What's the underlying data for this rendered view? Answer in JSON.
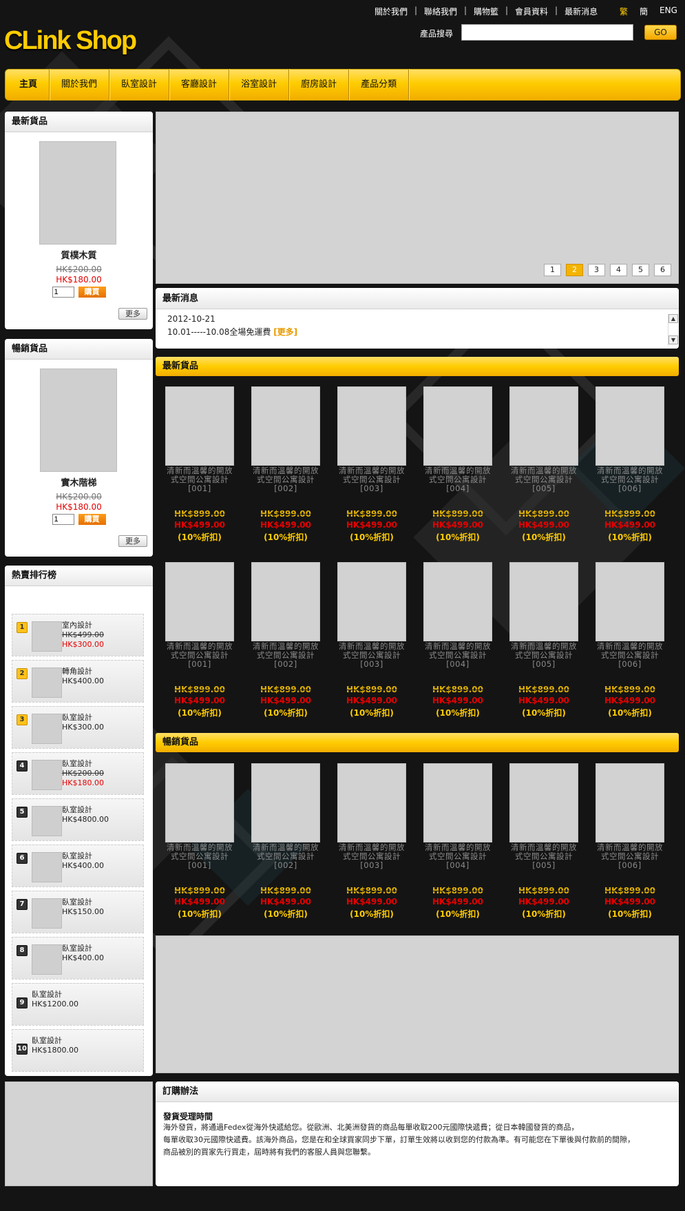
{
  "header": {
    "logo": "CLink Shop",
    "top_links": [
      "關於我們",
      "聯絡我們",
      "購物籃",
      "會員資料",
      "最新消息"
    ],
    "languages": [
      "繁",
      "簡",
      "ENG"
    ],
    "search_label": "產品搜尋",
    "search_value": "",
    "search_button": "GO"
  },
  "nav": [
    "主頁",
    "關於我們",
    "臥室設計",
    "客廳設計",
    "浴室設計",
    "廚房設計",
    "產品分類"
  ],
  "latest_side": {
    "title": "最新貨品",
    "name": "質樸木質",
    "old_price": "HK$200.00",
    "new_price": "HK$180.00",
    "qty": "1",
    "buy": "購買",
    "more": "更多"
  },
  "bestseller_side": {
    "title": "暢銷貨品",
    "name": "實木階梯",
    "old_price": "HK$200.00",
    "new_price": "HK$180.00",
    "qty": "1",
    "buy": "購買",
    "more": "更多"
  },
  "ranking": {
    "title": "熱賣排行榜",
    "items": [
      {
        "n": "1",
        "name": "室內設計",
        "old": "HK$499.00",
        "price": "HK$300.00"
      },
      {
        "n": "2",
        "name": "轉角設計",
        "old": "",
        "price": "HK$400.00"
      },
      {
        "n": "3",
        "name": "臥室設計",
        "old": "",
        "price": "HK$300.00"
      },
      {
        "n": "4",
        "name": "臥室設計",
        "old": "HK$200.00",
        "price": "HK$180.00"
      },
      {
        "n": "5",
        "name": "臥室設計",
        "old": "",
        "price": "HK$4800.00"
      },
      {
        "n": "6",
        "name": "臥室設計",
        "old": "",
        "price": "HK$400.00"
      },
      {
        "n": "7",
        "name": "臥室設計",
        "old": "",
        "price": "HK$150.00"
      },
      {
        "n": "8",
        "name": "臥室設計",
        "old": "",
        "price": "HK$400.00"
      },
      {
        "n": "9",
        "name": "臥室設計",
        "old": "",
        "price": "HK$1200.00"
      },
      {
        "n": "10",
        "name": "臥室設計",
        "old": "",
        "price": "HK$1800.00"
      }
    ]
  },
  "banner": {
    "pages": [
      "1",
      "2",
      "3",
      "4",
      "5",
      "6"
    ],
    "active_page": "2"
  },
  "news": {
    "title": "最新消息",
    "date": "2012-10-21",
    "text": "10.01-----10.08全場免運費",
    "more": "[更多]"
  },
  "latest_section": {
    "title": "最新貨品",
    "rows": [
      [
        {
          "name": "清新而溫馨的開放式空間公寓設計[001]",
          "old": "HK$899.00",
          "price": "HK$499.00",
          "discount": "(10%折扣)"
        },
        {
          "name": "清新而溫馨的開放式空間公寓設計[002]",
          "old": "HK$899.00",
          "price": "HK$499.00",
          "discount": "(10%折扣)"
        },
        {
          "name": "清新而溫馨的開放式空間公寓設計[003]",
          "old": "HK$899.00",
          "price": "HK$499.00",
          "discount": "(10%折扣)"
        },
        {
          "name": "清新而溫馨的開放式空間公寓設計[004]",
          "old": "HK$899.00",
          "price": "HK$499.00",
          "discount": "(10%折扣)"
        },
        {
          "name": "清新而溫馨的開放式空間公寓設計[005]",
          "old": "HK$899.00",
          "price": "HK$499.00",
          "discount": "(10%折扣)"
        },
        {
          "name": "清新而溫馨的開放式空間公寓設計[006]",
          "old": "HK$899.00",
          "price": "HK$499.00",
          "discount": "(10%折扣)"
        }
      ],
      [
        {
          "name": "清新而溫馨的開放式空間公寓設計[001]",
          "old": "HK$899.00",
          "price": "HK$499.00",
          "discount": "(10%折扣)"
        },
        {
          "name": "清新而溫馨的開放式空間公寓設計[002]",
          "old": "HK$899.00",
          "price": "HK$499.00",
          "discount": "(10%折扣)"
        },
        {
          "name": "清新而溫馨的開放式空間公寓設計[003]",
          "old": "HK$899.00",
          "price": "HK$499.00",
          "discount": "(10%折扣)"
        },
        {
          "name": "清新而溫馨的開放式空間公寓設計[004]",
          "old": "HK$899.00",
          "price": "HK$499.00",
          "discount": "(10%折扣)"
        },
        {
          "name": "清新而溫馨的開放式空間公寓設計[005]",
          "old": "HK$899.00",
          "price": "HK$499.00",
          "discount": "(10%折扣)"
        },
        {
          "name": "清新而溫馨的開放式空間公寓設計[006]",
          "old": "HK$899.00",
          "price": "HK$499.00",
          "discount": "(10%折扣)"
        }
      ]
    ]
  },
  "bestseller_section": {
    "title": "暢銷貨品",
    "rows": [
      [
        {
          "name": "清新而溫馨的開放式空間公寓設計[001]",
          "old": "HK$899.00",
          "price": "HK$499.00",
          "discount": "(10%折扣)"
        },
        {
          "name": "清新而溫馨的開放式空間公寓設計[002]",
          "old": "HK$899.00",
          "price": "HK$499.00",
          "discount": "(10%折扣)"
        },
        {
          "name": "清新而溫馨的開放式空間公寓設計[003]",
          "old": "HK$899.00",
          "price": "HK$499.00",
          "discount": "(10%折扣)"
        },
        {
          "name": "清新而溫馨的開放式空間公寓設計[004]",
          "old": "HK$899.00",
          "price": "HK$499.00",
          "discount": "(10%折扣)"
        },
        {
          "name": "清新而溫馨的開放式空間公寓設計[005]",
          "old": "HK$899.00",
          "price": "HK$499.00",
          "discount": "(10%折扣)"
        },
        {
          "name": "清新而溫馨的開放式空間公寓設計[006]",
          "old": "HK$899.00",
          "price": "HK$499.00",
          "discount": "(10%折扣)"
        }
      ]
    ]
  },
  "order": {
    "title": "訂購辦法",
    "subtitle": "發貨受理時間",
    "lines": [
      "海外發貨，將通過Fedex從海外快遞給您。從歐洲、北美洲發貨的商品每單收取200元國際快遞費；從日本韓國發貨的商品，",
      "每單收取30元國際快遞費。該海外商品，您是在和全球買家同步下單，訂單生效將以收到您的付款為準。有可能您在下單後與付款前的間隙，",
      "商品被別的買家先行買走，屆時將有我們的客服人員與您聯繫。"
    ]
  },
  "colors": {
    "accent": "#ffcc00",
    "price_red": "#e60000",
    "background": "#141414"
  }
}
